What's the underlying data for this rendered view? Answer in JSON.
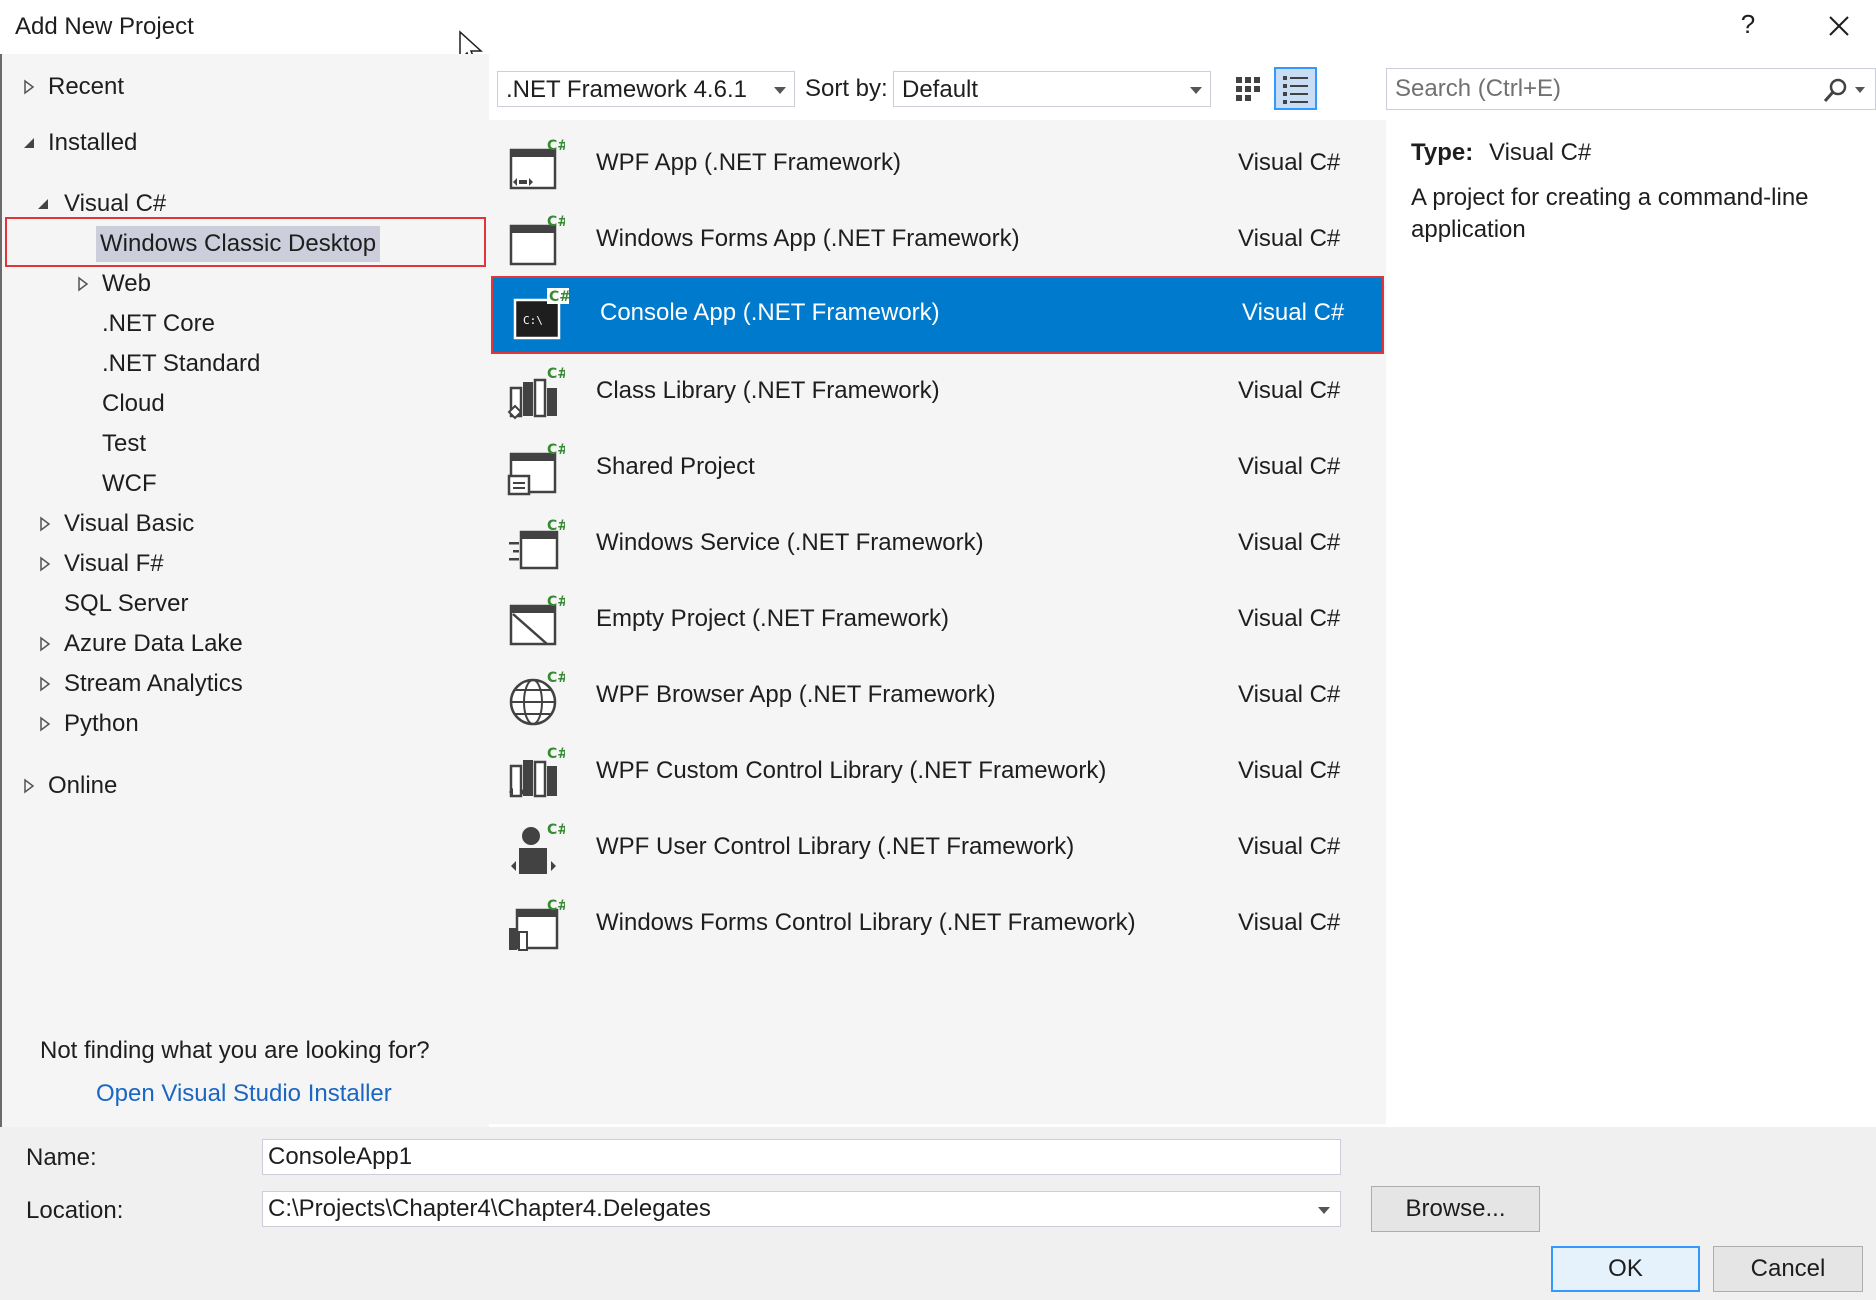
{
  "window": {
    "title": "Add New Project",
    "help_label": "?"
  },
  "tree": {
    "recent": "Recent",
    "installed": "Installed",
    "visual_csharp": "Visual C#",
    "windows_classic_desktop": "Windows Classic Desktop",
    "web": "Web",
    "net_core": ".NET Core",
    "net_standard": ".NET Standard",
    "cloud": "Cloud",
    "test": "Test",
    "wcf": "WCF",
    "visual_basic": "Visual Basic",
    "visual_fsharp": "Visual F#",
    "sql_server": "SQL Server",
    "azure_data_lake": "Azure Data Lake",
    "stream_analytics": "Stream Analytics",
    "python": "Python",
    "online": "Online"
  },
  "left_footer": {
    "not_finding": "Not finding what you are looking for?",
    "installer_link": "Open Visual Studio Installer"
  },
  "toolbar": {
    "framework": ".NET Framework 4.6.1",
    "sort_label": "Sort by:",
    "sort_value": "Default"
  },
  "search": {
    "placeholder": "Search (Ctrl+E)"
  },
  "templates": [
    {
      "name": "WPF App (.NET Framework)",
      "lang": "Visual C#"
    },
    {
      "name": "Windows Forms App (.NET Framework)",
      "lang": "Visual C#"
    },
    {
      "name": "Console App (.NET Framework)",
      "lang": "Visual C#"
    },
    {
      "name": "Class Library (.NET Framework)",
      "lang": "Visual C#"
    },
    {
      "name": "Shared Project",
      "lang": "Visual C#"
    },
    {
      "name": "Windows Service (.NET Framework)",
      "lang": "Visual C#"
    },
    {
      "name": "Empty Project (.NET Framework)",
      "lang": "Visual C#"
    },
    {
      "name": "WPF Browser App (.NET Framework)",
      "lang": "Visual C#"
    },
    {
      "name": "WPF Custom Control Library (.NET Framework)",
      "lang": "Visual C#"
    },
    {
      "name": "WPF User Control Library (.NET Framework)",
      "lang": "Visual C#"
    },
    {
      "name": "Windows Forms Control Library (.NET Framework)",
      "lang": "Visual C#"
    }
  ],
  "description": {
    "type_label": "Type:",
    "type_value": "Visual C#",
    "text": "A project for creating a command-line application"
  },
  "form": {
    "name_label": "Name:",
    "name_value": "ConsoleApp1",
    "location_label": "Location:",
    "location_value": "C:\\Projects\\Chapter4\\Chapter4.Delegates",
    "browse_label": "Browse...",
    "ok_label": "OK",
    "cancel_label": "Cancel"
  },
  "icons": {
    "csharp_badge": "C#",
    "console_prompt": "C:\\"
  },
  "colors": {
    "selection_blue": "#007acc",
    "highlight_red": "#e0353a",
    "link_blue": "#1a66c2",
    "csharp_green": "#388a34"
  }
}
